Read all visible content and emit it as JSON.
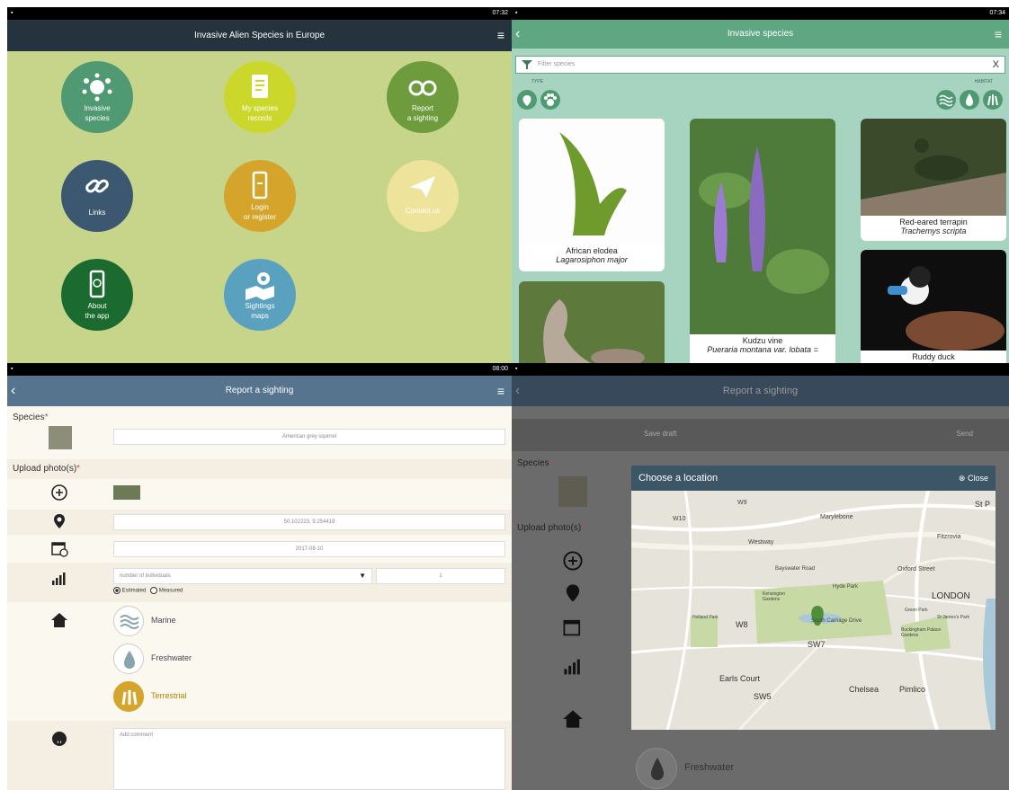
{
  "home": {
    "status_time": "07:32",
    "title": "Invasive Alien Species in Europe",
    "tiles": [
      {
        "label_1": "Invasive",
        "label_2": "species",
        "color": "#4f9a72"
      },
      {
        "label_1": "My species",
        "label_2": "records",
        "color": "#cbd82b"
      },
      {
        "label_1": "Report",
        "label_2": "a sighting",
        "color": "#6e9b3b"
      },
      {
        "label_1": "Links",
        "label_2": "",
        "color": "#3b5870"
      },
      {
        "label_1": "Login",
        "label_2": "or register",
        "color": "#d4a52a"
      },
      {
        "label_1": "Contact us",
        "label_2": "",
        "color": "#ede39a"
      },
      {
        "label_1": "About",
        "label_2": "the app",
        "color": "#1b6b30"
      },
      {
        "label_1": "Sightings",
        "label_2": "maps",
        "color": "#5aa1bf"
      }
    ]
  },
  "species": {
    "status_time": "07:34",
    "title": "Invasive species",
    "filter_placeholder": "Filter species",
    "filter_clear": "X",
    "type_label": "TYPE",
    "habitat_label": "HABITAT",
    "cards": [
      {
        "common": "African elodea",
        "scientific": "Lagarosiphon major"
      },
      {
        "common": "Kudzu vine",
        "scientific": "Pueraria montana var. lobata ="
      },
      {
        "common": "Red-eared terrapin",
        "scientific": "Trachemys scripta"
      },
      {
        "common": "Ruddy duck",
        "scientific": ""
      }
    ]
  },
  "report": {
    "status_time": "08:00",
    "title": "Report a sighting",
    "species_label": "Species",
    "species_value": "American grey squirrel",
    "upload_label": "Upload photo(s)",
    "location_value": "50.102223, 9.254419",
    "date_value": "2017-08-10",
    "count_placeholder": "number of individuals",
    "count_value": "1",
    "estimated_label": "Estimated",
    "measured_label": "Measured",
    "habitats": [
      "Marine",
      "Freshwater",
      "Terrestrial"
    ],
    "comment_placeholder": "Add comment"
  },
  "map_dialog": {
    "title": "Report a sighting",
    "save_draft": "Save draft",
    "send": "Send",
    "species_label": "Species",
    "upload_label": "Upload photo(s)",
    "dialog_title": "Choose a location",
    "close_label": "Close",
    "freshwater_label": "Freshwater",
    "places": [
      "W9",
      "Marylebone",
      "W10",
      "Westway",
      "Fitzrovia",
      "Oxford Street",
      "Bayswater Road",
      "Hyde Park",
      "Kensington Gardens",
      "Holland Park",
      "W8",
      "South Carriage Drive",
      "LONDON",
      "Green Park",
      "St James's Park",
      "Buckingham Palace Gardens",
      "SW7",
      "Earls Court",
      "SW5",
      "Chelsea",
      "Pimlico",
      "St P"
    ]
  }
}
